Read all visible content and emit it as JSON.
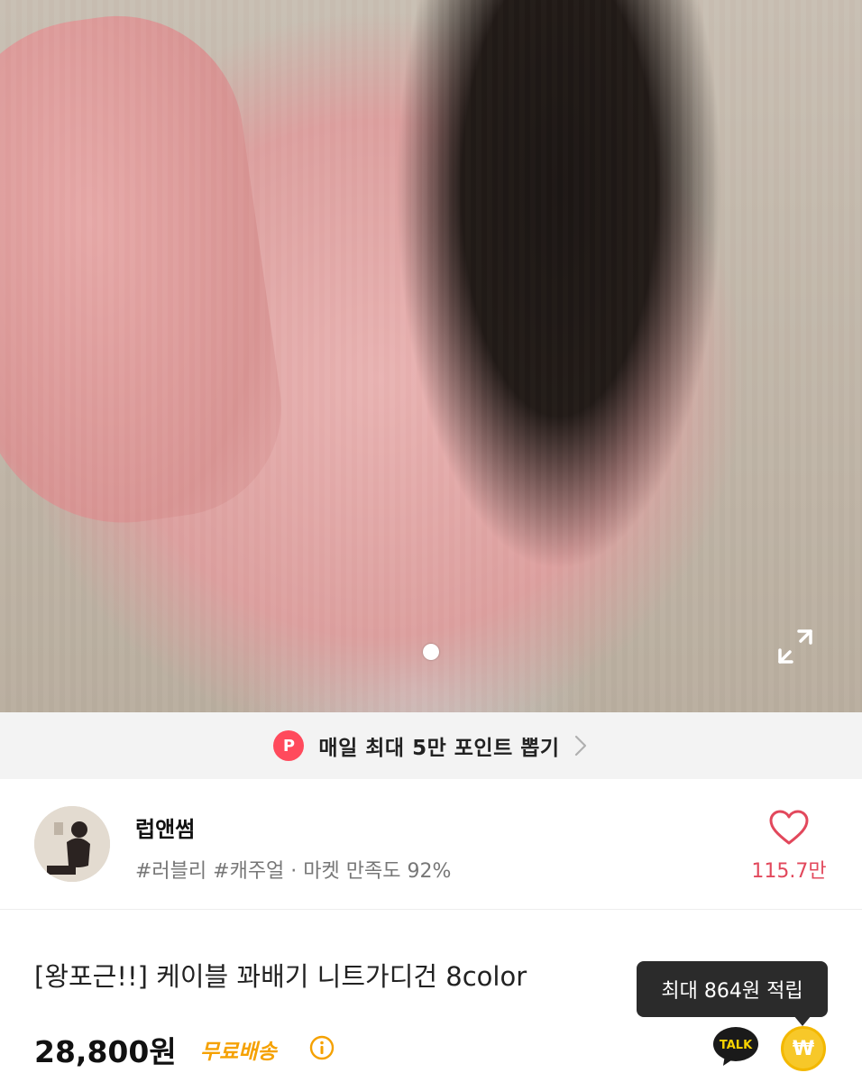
{
  "hero": {
    "image_alt": "pink cable knit sweater photo",
    "icons": {
      "carousel_dot": "carousel-dot",
      "expand": "expand-icon"
    }
  },
  "point_banner": {
    "badge": "P",
    "text": "매일 최대 5만 포인트 뽑기",
    "badge_color": "#ff4a5c"
  },
  "seller": {
    "name": "럽앤썸",
    "tags": "#러블리 #캐주얼 · 마켓 만족도 92%",
    "likes": "115.7만",
    "accent": "#e2485c"
  },
  "product": {
    "title": "[왕포근!!] 케이블 꽈배기 니트가디건 8color",
    "price": "28,800원",
    "shipping": "무료배송",
    "shipping_color": "#f5a100"
  },
  "reward": {
    "tooltip": "최대 864원 적립",
    "talk_label": "TALK",
    "coin_symbol": "₩"
  }
}
